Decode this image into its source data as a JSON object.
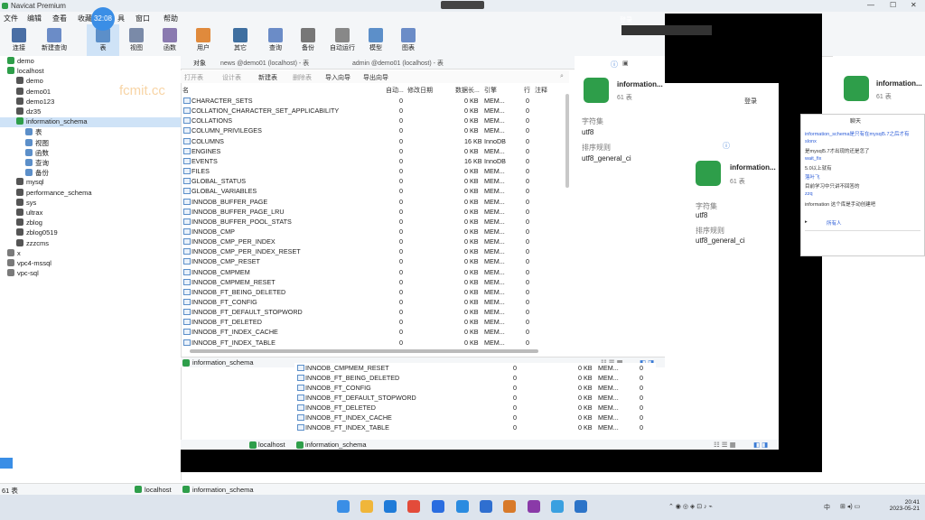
{
  "app": {
    "title": "Navicat Premium",
    "timer": "32:08"
  },
  "menu": [
    "文件",
    "编辑",
    "查看",
    "收藏",
    "具",
    "窗口",
    "帮助"
  ],
  "toolbar": [
    {
      "label": "连接",
      "icon": "connect-icon"
    },
    {
      "label": "新建查询",
      "icon": "new-query-icon"
    },
    {
      "label": "表",
      "icon": "table-icon"
    },
    {
      "label": "视图",
      "icon": "view-icon"
    },
    {
      "label": "函数",
      "icon": "function-icon"
    },
    {
      "label": "用户",
      "icon": "user-icon"
    },
    {
      "label": "其它",
      "icon": "other-icon"
    },
    {
      "label": "查询",
      "icon": "query-icon"
    },
    {
      "label": "备份",
      "icon": "backup-icon"
    },
    {
      "label": "自动运行",
      "icon": "autorun-icon"
    },
    {
      "label": "模型",
      "icon": "model-icon"
    },
    {
      "label": "图表",
      "icon": "chart-icon"
    }
  ],
  "tree": [
    {
      "label": "demo",
      "level": 0,
      "type": "srv"
    },
    {
      "label": "localhost",
      "level": 0,
      "type": "srv"
    },
    {
      "label": "demo",
      "level": 1,
      "type": "db"
    },
    {
      "label": "demo01",
      "level": 1,
      "type": "db"
    },
    {
      "label": "demo123",
      "level": 1,
      "type": "db"
    },
    {
      "label": "dz35",
      "level": 1,
      "type": "db"
    },
    {
      "label": "information_schema",
      "level": 1,
      "type": "dbgreen",
      "selected": true
    },
    {
      "label": "表",
      "level": 2,
      "type": "fold"
    },
    {
      "label": "视图",
      "level": 2,
      "type": "fold"
    },
    {
      "label": "函数",
      "level": 2,
      "type": "fold"
    },
    {
      "label": "查询",
      "level": 2,
      "type": "fold"
    },
    {
      "label": "备份",
      "level": 2,
      "type": "fold"
    },
    {
      "label": "mysql",
      "level": 1,
      "type": "db"
    },
    {
      "label": "performance_schema",
      "level": 1,
      "type": "db"
    },
    {
      "label": "sys",
      "level": 1,
      "type": "db"
    },
    {
      "label": "ultrax",
      "level": 1,
      "type": "db"
    },
    {
      "label": "zblog",
      "level": 1,
      "type": "db"
    },
    {
      "label": "zblog0519",
      "level": 1,
      "type": "db"
    },
    {
      "label": "zzzcms",
      "level": 1,
      "type": "db"
    },
    {
      "label": "x",
      "level": 0,
      "type": "srvx"
    },
    {
      "label": "vpc4-mssql",
      "level": 0,
      "type": "srvx"
    },
    {
      "label": "vpc-sql",
      "level": 0,
      "type": "srvx"
    }
  ],
  "watermark": "fcmit.cc",
  "tabs": [
    "对象",
    "news @demo01 (localhost) - 表",
    "admin @demo01 (localhost) - 表"
  ],
  "objtoolbar": [
    "打开表",
    "设计表",
    "新建表",
    "删除表",
    "导入向导",
    "导出向导"
  ],
  "columns": {
    "name": "名",
    "auto": "自动...",
    "modified": "修改日期",
    "size": "数据长...",
    "engine": "引擎",
    "rows": "行",
    "comment": "注释"
  },
  "table_rows": [
    {
      "n": "CHARACTER_SETS",
      "a": "0",
      "s": "0 KB",
      "e": "MEM...",
      "r": "0"
    },
    {
      "n": "COLLATION_CHARACTER_SET_APPLICABILITY",
      "a": "0",
      "s": "0 KB",
      "e": "MEM...",
      "r": "0"
    },
    {
      "n": "COLLATIONS",
      "a": "0",
      "s": "0 KB",
      "e": "MEM...",
      "r": "0"
    },
    {
      "n": "COLUMN_PRIVILEGES",
      "a": "0",
      "s": "0 KB",
      "e": "MEM...",
      "r": "0"
    },
    {
      "n": "COLUMNS",
      "a": "0",
      "s": "16 KB",
      "e": "InnoDB",
      "r": "0"
    },
    {
      "n": "ENGINES",
      "a": "0",
      "s": "0 KB",
      "e": "MEM...",
      "r": "0"
    },
    {
      "n": "EVENTS",
      "a": "0",
      "s": "16 KB",
      "e": "InnoDB",
      "r": "0"
    },
    {
      "n": "FILES",
      "a": "0",
      "s": "0 KB",
      "e": "MEM...",
      "r": "0"
    },
    {
      "n": "GLOBAL_STATUS",
      "a": "0",
      "s": "0 KB",
      "e": "MEM...",
      "r": "0"
    },
    {
      "n": "GLOBAL_VARIABLES",
      "a": "0",
      "s": "0 KB",
      "e": "MEM...",
      "r": "0"
    },
    {
      "n": "INNODB_BUFFER_PAGE",
      "a": "0",
      "s": "0 KB",
      "e": "MEM...",
      "r": "0"
    },
    {
      "n": "INNODB_BUFFER_PAGE_LRU",
      "a": "0",
      "s": "0 KB",
      "e": "MEM...",
      "r": "0"
    },
    {
      "n": "INNODB_BUFFER_POOL_STATS",
      "a": "0",
      "s": "0 KB",
      "e": "MEM...",
      "r": "0"
    },
    {
      "n": "INNODB_CMP",
      "a": "0",
      "s": "0 KB",
      "e": "MEM...",
      "r": "0"
    },
    {
      "n": "INNODB_CMP_PER_INDEX",
      "a": "0",
      "s": "0 KB",
      "e": "MEM...",
      "r": "0"
    },
    {
      "n": "INNODB_CMP_PER_INDEX_RESET",
      "a": "0",
      "s": "0 KB",
      "e": "MEM...",
      "r": "0"
    },
    {
      "n": "INNODB_CMP_RESET",
      "a": "0",
      "s": "0 KB",
      "e": "MEM...",
      "r": "0"
    },
    {
      "n": "INNODB_CMPMEM",
      "a": "0",
      "s": "0 KB",
      "e": "MEM...",
      "r": "0"
    },
    {
      "n": "INNODB_CMPMEM_RESET",
      "a": "0",
      "s": "0 KB",
      "e": "MEM...",
      "r": "0"
    },
    {
      "n": "INNODB_FT_BEING_DELETED",
      "a": "0",
      "s": "0 KB",
      "e": "MEM...",
      "r": "0"
    },
    {
      "n": "INNODB_FT_CONFIG",
      "a": "0",
      "s": "0 KB",
      "e": "MEM...",
      "r": "0"
    },
    {
      "n": "INNODB_FT_DEFAULT_STOPWORD",
      "a": "0",
      "s": "0 KB",
      "e": "MEM...",
      "r": "0"
    },
    {
      "n": "INNODB_FT_DELETED",
      "a": "0",
      "s": "0 KB",
      "e": "MEM...",
      "r": "0"
    },
    {
      "n": "INNODB_FT_INDEX_CACHE",
      "a": "0",
      "s": "0 KB",
      "e": "MEM...",
      "r": "0"
    },
    {
      "n": "INNODB_FT_INDEX_TABLE",
      "a": "0",
      "s": "0 KB",
      "e": "MEM...",
      "r": "0"
    }
  ],
  "info": {
    "name": "information...",
    "count": "61 表",
    "charset_label": "字符集",
    "charset": "utf8",
    "collation_label": "排序规则",
    "collation": "utf8_general_ci"
  },
  "status": {
    "db": "information_schema",
    "conn": "localhost",
    "count": "61 表"
  },
  "rows2": [
    {
      "n": "INNODB_CMPMEM_RESET",
      "a": "0",
      "s": "0 KB",
      "e": "MEM...",
      "r": "0"
    },
    {
      "n": "INNODB_FT_BEING_DELETED",
      "a": "0",
      "s": "0 KB",
      "e": "MEM...",
      "r": "0"
    },
    {
      "n": "INNODB_FT_CONFIG",
      "a": "0",
      "s": "0 KB",
      "e": "MEM...",
      "r": "0"
    },
    {
      "n": "INNODB_FT_DEFAULT_STOPWORD",
      "a": "0",
      "s": "0 KB",
      "e": "MEM...",
      "r": "0"
    },
    {
      "n": "INNODB_FT_DELETED",
      "a": "0",
      "s": "0 KB",
      "e": "MEM...",
      "r": "0"
    },
    {
      "n": "INNODB_FT_INDEX_CACHE",
      "a": "0",
      "s": "0 KB",
      "e": "MEM...",
      "r": "0"
    },
    {
      "n": "INNODB_FT_INDEX_TABLE",
      "a": "0",
      "s": "0 KB",
      "e": "MEM...",
      "r": "0"
    }
  ],
  "login": "登录",
  "chat": {
    "title": "聊天",
    "lines": [
      "information_schema是只有在mysql5.7之后才有",
      "slonx",
      "是mysql5.7才出现的还是怎了",
      "wait_fix",
      "5.0以上就有",
      "落叶飞",
      "目前学习中只讲不回答的",
      "zzq",
      "information 这个库是手动创建吧"
    ],
    "send_to": "所有人"
  },
  "clock": {
    "time": "20:41",
    "date": "2023-05-21"
  }
}
